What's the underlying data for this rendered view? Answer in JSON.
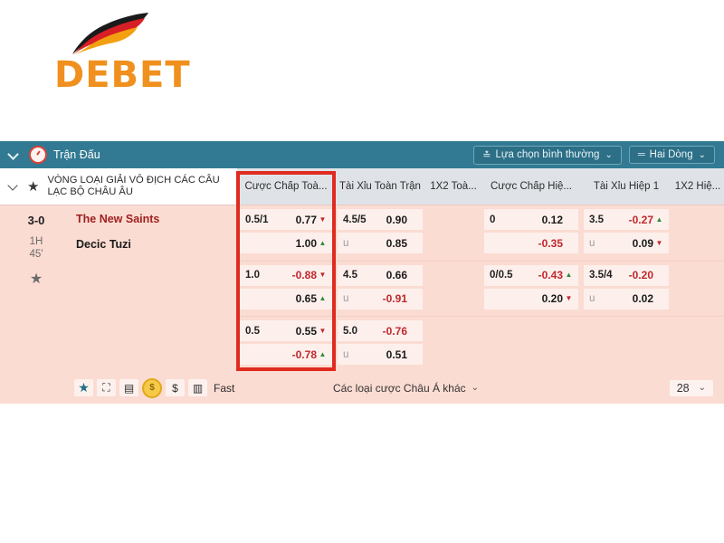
{
  "brand": {
    "name": "DEBET",
    "swoosh_colors": [
      "#1b1b1b",
      "#d81f26",
      "#f2a00f"
    ],
    "text_color": "#f0901e"
  },
  "topbar": {
    "title": "Trận Đấu",
    "clock_icon": "clock-icon",
    "collapse_icon": "chevron-down-icon",
    "buttons": [
      {
        "label": "Lựa chọn bình thường",
        "glyph": "≛",
        "caret": "⌄",
        "name": "normal-selection-dropdown"
      },
      {
        "label": "Hai Dòng",
        "glyph": "═",
        "caret": "⌄",
        "name": "two-rows-dropdown"
      }
    ]
  },
  "league": {
    "name": "VÒNG LOẠI GIẢI VÔ ĐỊCH CÁC CÂU LẠC BỘ CHÂU ÂU",
    "star_icon": "star-icon",
    "collapse_icon": "chevron-down-icon"
  },
  "columns": [
    "Cược Chấp Toà...",
    "Tài Xỉu Toàn Trận",
    "1X2 Toà...",
    "Cược Chấp Hiệ...",
    "Tài Xỉu Hiệp 1",
    "1X2 Hiệ..."
  ],
  "match": {
    "score": "3-0",
    "period_line1": "1H",
    "period_line2": "45'",
    "favorite_icon": "star-icon",
    "home_team": "The New Saints",
    "away_team": "Decic Tuzi",
    "home_color": "#9f1f1f",
    "away_color": "#1b1b1b"
  },
  "odds": [
    {
      "handicap_full": {
        "top": {
          "line": "0.5/1",
          "price": "0.77",
          "arrow": "down",
          "neg": false
        },
        "bottom": {
          "line": "",
          "price": "1.00",
          "arrow": "up",
          "neg": false
        }
      },
      "ou_full": {
        "top": {
          "line": "4.5/5",
          "price": "0.90",
          "arrow": "none",
          "neg": false
        },
        "bottom": {
          "line": "u",
          "price": "0.85",
          "arrow": "none",
          "neg": false
        }
      },
      "x12_full": {
        "top": null,
        "bottom": null
      },
      "handicap_half": {
        "top": {
          "line": "0",
          "price": "0.12",
          "arrow": "none",
          "neg": false
        },
        "bottom": {
          "line": "",
          "price": "-0.35",
          "arrow": "none",
          "neg": true
        }
      },
      "ou_half": {
        "top": {
          "line": "3.5",
          "price": "-0.27",
          "arrow": "up",
          "neg": true
        },
        "bottom": {
          "line": "u",
          "price": "0.09",
          "arrow": "down",
          "neg": false
        }
      },
      "x12_half": {
        "top": null,
        "bottom": null
      }
    },
    {
      "handicap_full": {
        "top": {
          "line": "1.0",
          "price": "-0.88",
          "arrow": "down",
          "neg": true
        },
        "bottom": {
          "line": "",
          "price": "0.65",
          "arrow": "up",
          "neg": false
        }
      },
      "ou_full": {
        "top": {
          "line": "4.5",
          "price": "0.66",
          "arrow": "none",
          "neg": false
        },
        "bottom": {
          "line": "u",
          "price": "-0.91",
          "arrow": "none",
          "neg": true
        }
      },
      "x12_full": {
        "top": null,
        "bottom": null
      },
      "handicap_half": {
        "top": {
          "line": "0/0.5",
          "price": "-0.43",
          "arrow": "up",
          "neg": true
        },
        "bottom": {
          "line": "",
          "price": "0.20",
          "arrow": "down",
          "neg": false
        }
      },
      "ou_half": {
        "top": {
          "line": "3.5/4",
          "price": "-0.20",
          "arrow": "none",
          "neg": true
        },
        "bottom": {
          "line": "u",
          "price": "0.02",
          "arrow": "none",
          "neg": false
        }
      },
      "x12_half": {
        "top": null,
        "bottom": null
      }
    },
    {
      "handicap_full": {
        "top": {
          "line": "0.5",
          "price": "0.55",
          "arrow": "down",
          "neg": false
        },
        "bottom": {
          "line": "",
          "price": "-0.78",
          "arrow": "up",
          "neg": true
        }
      },
      "ou_full": {
        "top": {
          "line": "5.0",
          "price": "-0.76",
          "arrow": "none",
          "neg": true
        },
        "bottom": {
          "line": "u",
          "price": "0.51",
          "arrow": "none",
          "neg": false
        }
      },
      "x12_full": {
        "top": null,
        "bottom": null
      },
      "handicap_half": {
        "top": null,
        "bottom": null
      },
      "ou_half": {
        "top": null,
        "bottom": null
      },
      "x12_half": {
        "top": null,
        "bottom": null
      }
    }
  ],
  "bottombar": {
    "icons": [
      {
        "name": "star-icon",
        "glyph": "★"
      },
      {
        "name": "pitch-icon",
        "glyph": "⛶"
      },
      {
        "name": "card-icon",
        "glyph": "▤"
      },
      {
        "name": "coin-icon",
        "glyph": "$"
      },
      {
        "name": "dollar-icon",
        "glyph": "$"
      },
      {
        "name": "stats-icon",
        "glyph": "▥"
      }
    ],
    "fast_label": "Fast",
    "other_bets_label": "Các loại cược Châu Á khác",
    "other_bets_caret": "⌄",
    "page_count": "28",
    "page_caret": "⌄"
  },
  "annotation": {
    "name": "red-highlight-box",
    "color": "#e02b20"
  }
}
